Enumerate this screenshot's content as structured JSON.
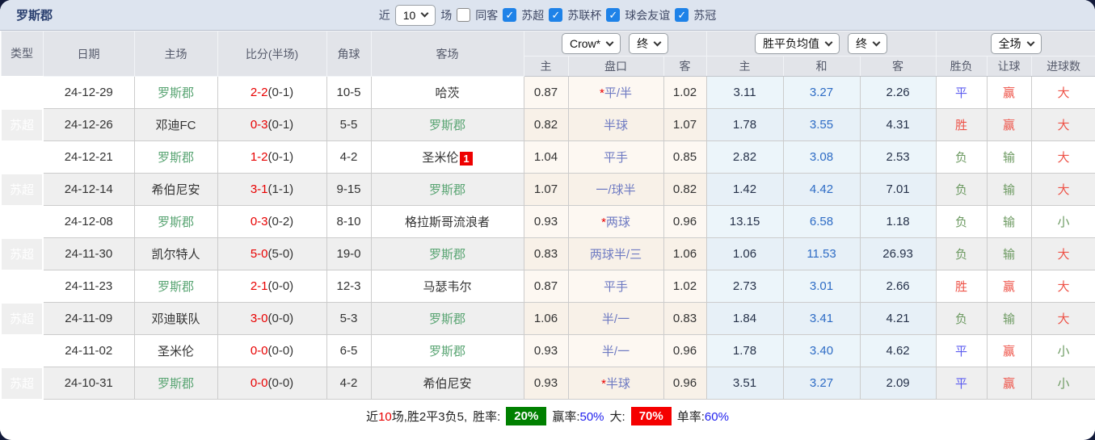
{
  "title": "罗斯郡",
  "topbar": {
    "near_label": "近",
    "count_select": "10",
    "matches_label": "场",
    "same_away": {
      "label": "同客",
      "checked": false
    },
    "leagues": [
      {
        "label": "苏超",
        "checked": true
      },
      {
        "label": "苏联杯",
        "checked": true
      },
      {
        "label": "球会友谊",
        "checked": true
      },
      {
        "label": "苏冠",
        "checked": true
      }
    ],
    "check_glyph": "✓"
  },
  "table_header": {
    "type": "类型",
    "date": "日期",
    "home": "主场",
    "score": "比分(半场)",
    "corners": "角球",
    "away": "客场",
    "bookmaker_select": "Crow*",
    "odds_time_select": "终",
    "avg_select": "胜平负均值",
    "avg_time_select": "终",
    "scope_select": "全场",
    "odds_cols": {
      "home": "主",
      "handicap": "盘口",
      "away": "客"
    },
    "avg_cols": {
      "home": "主",
      "draw": "和",
      "away": "客"
    },
    "result_cols": {
      "wdl": "胜负",
      "handicap": "让球",
      "goals": "进球数"
    }
  },
  "rows": [
    {
      "league": "苏超",
      "date": "24-12-29",
      "home": "罗斯郡",
      "home_active": true,
      "score": "2-2",
      "half": "(0-1)",
      "corners": "10-5",
      "away": "哈茨",
      "away_active": false,
      "away_badge": "",
      "odds": {
        "home": "0.87",
        "handicap": "平/半",
        "handicap_star": true,
        "away": "1.02"
      },
      "avg": {
        "home": "3.11",
        "draw": "3.27",
        "away": "2.26"
      },
      "result": {
        "wdl": "平",
        "handicap": "赢",
        "goals": "大"
      }
    },
    {
      "league": "苏超",
      "date": "24-12-26",
      "home": "邓迪FC",
      "home_active": false,
      "score": "0-3",
      "half": "(0-1)",
      "corners": "5-5",
      "away": "罗斯郡",
      "away_active": true,
      "away_badge": "",
      "odds": {
        "home": "0.82",
        "handicap": "半球",
        "handicap_star": false,
        "away": "1.07"
      },
      "avg": {
        "home": "1.78",
        "draw": "3.55",
        "away": "4.31"
      },
      "result": {
        "wdl": "胜",
        "handicap": "赢",
        "goals": "大"
      }
    },
    {
      "league": "苏超",
      "date": "24-12-21",
      "home": "罗斯郡",
      "home_active": true,
      "score": "1-2",
      "half": "(0-1)",
      "corners": "4-2",
      "away": "圣米伦",
      "away_active": false,
      "away_badge": "1",
      "odds": {
        "home": "1.04",
        "handicap": "平手",
        "handicap_star": false,
        "away": "0.85"
      },
      "avg": {
        "home": "2.82",
        "draw": "3.08",
        "away": "2.53"
      },
      "result": {
        "wdl": "负",
        "handicap": "输",
        "goals": "大"
      }
    },
    {
      "league": "苏超",
      "date": "24-12-14",
      "home": "希伯尼安",
      "home_active": false,
      "score": "3-1",
      "half": "(1-1)",
      "corners": "9-15",
      "away": "罗斯郡",
      "away_active": true,
      "away_badge": "",
      "odds": {
        "home": "1.07",
        "handicap": "一/球半",
        "handicap_star": false,
        "away": "0.82"
      },
      "avg": {
        "home": "1.42",
        "draw": "4.42",
        "away": "7.01"
      },
      "result": {
        "wdl": "负",
        "handicap": "输",
        "goals": "大"
      }
    },
    {
      "league": "苏超",
      "date": "24-12-08",
      "home": "罗斯郡",
      "home_active": true,
      "score": "0-3",
      "half": "(0-2)",
      "corners": "8-10",
      "away": "格拉斯哥流浪者",
      "away_active": false,
      "away_badge": "",
      "odds": {
        "home": "0.93",
        "handicap": "两球",
        "handicap_star": true,
        "away": "0.96"
      },
      "avg": {
        "home": "13.15",
        "draw": "6.58",
        "away": "1.18"
      },
      "result": {
        "wdl": "负",
        "handicap": "输",
        "goals": "小"
      }
    },
    {
      "league": "苏超",
      "date": "24-11-30",
      "home": "凯尔特人",
      "home_active": false,
      "score": "5-0",
      "half": "(5-0)",
      "corners": "19-0",
      "away": "罗斯郡",
      "away_active": true,
      "away_badge": "",
      "odds": {
        "home": "0.83",
        "handicap": "两球半/三",
        "handicap_star": false,
        "away": "1.06"
      },
      "avg": {
        "home": "1.06",
        "draw": "11.53",
        "away": "26.93"
      },
      "result": {
        "wdl": "负",
        "handicap": "输",
        "goals": "大"
      }
    },
    {
      "league": "苏超",
      "date": "24-11-23",
      "home": "罗斯郡",
      "home_active": true,
      "score": "2-1",
      "half": "(0-0)",
      "corners": "12-3",
      "away": "马瑟韦尔",
      "away_active": false,
      "away_badge": "",
      "odds": {
        "home": "0.87",
        "handicap": "平手",
        "handicap_star": false,
        "away": "1.02"
      },
      "avg": {
        "home": "2.73",
        "draw": "3.01",
        "away": "2.66"
      },
      "result": {
        "wdl": "胜",
        "handicap": "赢",
        "goals": "大"
      }
    },
    {
      "league": "苏超",
      "date": "24-11-09",
      "home": "邓迪联队",
      "home_active": false,
      "score": "3-0",
      "half": "(0-0)",
      "corners": "5-3",
      "away": "罗斯郡",
      "away_active": true,
      "away_badge": "",
      "odds": {
        "home": "1.06",
        "handicap": "半/一",
        "handicap_star": false,
        "away": "0.83"
      },
      "avg": {
        "home": "1.84",
        "draw": "3.41",
        "away": "4.21"
      },
      "result": {
        "wdl": "负",
        "handicap": "输",
        "goals": "大"
      }
    },
    {
      "league": "苏超",
      "date": "24-11-02",
      "home": "圣米伦",
      "home_active": false,
      "score": "0-0",
      "half": "(0-0)",
      "corners": "6-5",
      "away": "罗斯郡",
      "away_active": true,
      "away_badge": "",
      "odds": {
        "home": "0.93",
        "handicap": "半/一",
        "handicap_star": false,
        "away": "0.96"
      },
      "avg": {
        "home": "1.78",
        "draw": "3.40",
        "away": "4.62"
      },
      "result": {
        "wdl": "平",
        "handicap": "赢",
        "goals": "小"
      }
    },
    {
      "league": "苏超",
      "date": "24-10-31",
      "home": "罗斯郡",
      "home_active": true,
      "score": "0-0",
      "half": "(0-0)",
      "corners": "4-2",
      "away": "希伯尼安",
      "away_active": false,
      "away_badge": "",
      "odds": {
        "home": "0.93",
        "handicap": "半球",
        "handicap_star": true,
        "away": "0.96"
      },
      "avg": {
        "home": "3.51",
        "draw": "3.27",
        "away": "2.09"
      },
      "result": {
        "wdl": "平",
        "handicap": "赢",
        "goals": "小"
      }
    }
  ],
  "color_maps": {
    "wdl": {
      "胜": "c-red",
      "平": "c-blue",
      "负": "c-green"
    },
    "result": {
      "赢": "c-red",
      "输": "c-green",
      "大": "c-red",
      "小": "c-green"
    }
  },
  "footer": {
    "near_prefix": "近",
    "near_count": "10",
    "summary_text": "场,胜2平3负5,",
    "win_rate_label": "胜率:",
    "win_rate": "20%",
    "handicap_rate_label": "赢率:",
    "handicap_rate": "50%",
    "big_label": "大:",
    "big_rate": "70%",
    "single_rate_label": "单率:",
    "single_rate": "60%"
  },
  "colors": {
    "page_background": "#121a3a",
    "topbar_background": "#dde4ef",
    "header_background": "#e2e4e9",
    "league_cell_green": "#62ac7e",
    "team_green": "#58a472",
    "score_red": "#e80000",
    "handicap_blue": "#6e7ac2",
    "avg_draw_blue": "#2e6cc5",
    "result_red": "#ee5348",
    "result_blue": "#5c5cf0",
    "result_green": "#6d9a62",
    "checkbox_blue": "#1e82e8",
    "badge_red": "#ee0000",
    "footer_badge_green": "#008000",
    "footer_badge_red": "#f50000",
    "footer_blue": "#2222ee"
  }
}
